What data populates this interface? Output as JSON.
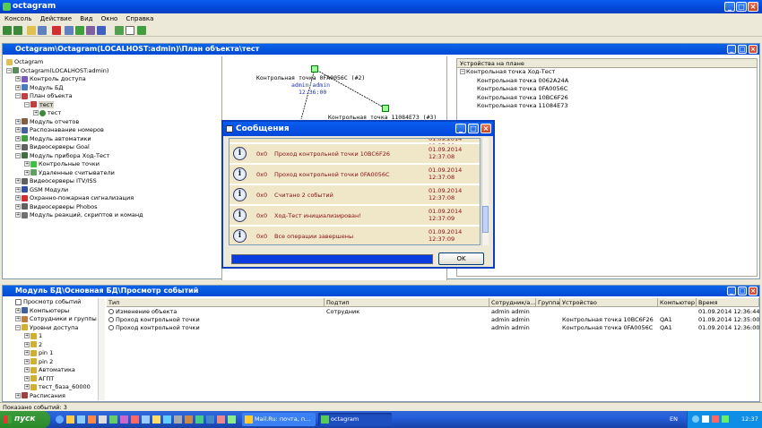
{
  "app": {
    "title": "octagram"
  },
  "menu": [
    "Консоль",
    "Действие",
    "Вид",
    "Окно",
    "Справка"
  ],
  "plan_window": {
    "title": "Octagram\\Octagram(LOCALHOST:admin)\\План объекта\\тест",
    "tree": [
      {
        "label": "Octagram",
        "level": 0
      },
      {
        "label": "Octagram(LOCALHOST:admin)",
        "level": 0
      },
      {
        "label": "Контроль доступа",
        "level": 1
      },
      {
        "label": "Модуль БД",
        "level": 1
      },
      {
        "label": "План объекта",
        "level": 1
      },
      {
        "label": "тест",
        "level": 2
      },
      {
        "label": "тест",
        "level": 3
      },
      {
        "label": "Модуль отчетов",
        "level": 1
      },
      {
        "label": "Распознавание номеров",
        "level": 1
      },
      {
        "label": "Модуль автоматики",
        "level": 1
      },
      {
        "label": "Видеосерверы Goal",
        "level": 1
      },
      {
        "label": "Модуль прибора Ход-Тест",
        "level": 1
      },
      {
        "label": "Контрольные точки",
        "level": 2
      },
      {
        "label": "Удаленные считыватели",
        "level": 2
      },
      {
        "label": "Видеосерверы ITV/ISS",
        "level": 1
      },
      {
        "label": "GSM Модули",
        "level": 1
      },
      {
        "label": "Охранно-пожарная сигнализация",
        "level": 1
      },
      {
        "label": "Видеосерверы Phobos",
        "level": 1
      },
      {
        "label": "Модуль реакций, скриптов и команд",
        "level": 1
      }
    ],
    "plan": {
      "point1_label": "Контрольная точка 0FA0056C (#2)",
      "point1_user": "admin admin",
      "point1_time": "12:36:00",
      "point2_label": "Контрольная точка 11084E73 (#3)"
    },
    "devices": {
      "header": "Устройства на плане",
      "root": "Контрольная точка Ход-Тест",
      "items": [
        "Контрольная точка 0062A24A",
        "Контрольная точка 0FA0056C",
        "Контрольная точка 10BC6F26",
        "Контрольная точка 11084E73"
      ]
    }
  },
  "dialog": {
    "title": "Сообщения",
    "partial_top": "01.09.2014 12:37:08",
    "messages": [
      {
        "code": "0x0",
        "text": "Проход контрольной точки 10BC6F26",
        "date": "01.09.2014",
        "time": "12:37:08"
      },
      {
        "code": "0x0",
        "text": "Проход контрольной точки 0FA0056C",
        "date": "01.09.2014",
        "time": "12:37:08"
      },
      {
        "code": "0x0",
        "text": "Считано 2 событий",
        "date": "01.09.2014",
        "time": "12:37:08"
      },
      {
        "code": "0x0",
        "text": "Ход-Тест инициализирован!",
        "date": "01.09.2014",
        "time": "12:37:09"
      },
      {
        "code": "0x0",
        "text": "Все операции завершены",
        "date": "01.09.2014",
        "time": "12:37:09"
      }
    ],
    "ok_label": "OK",
    "progress": 1.0
  },
  "events_window": {
    "title": "Модуль БД\\Основная БД\\Просмотр событий",
    "tree": [
      {
        "label": "Просмотр событий",
        "level": 0
      },
      {
        "label": "Компьютеры",
        "level": 0
      },
      {
        "label": "Сотрудники и группы",
        "level": 0
      },
      {
        "label": "Уровни доступа",
        "level": 0
      },
      {
        "label": "1",
        "level": 1
      },
      {
        "label": "2",
        "level": 1
      },
      {
        "label": "pin 1",
        "level": 1
      },
      {
        "label": "pin 2",
        "level": 1
      },
      {
        "label": "Автоматика",
        "level": 1
      },
      {
        "label": "АГПТ",
        "level": 1
      },
      {
        "label": "тест_база_60000",
        "level": 1
      },
      {
        "label": "Расписания",
        "level": 0
      }
    ],
    "columns": [
      "Тип",
      "Подтип",
      "Сотрудник/а...",
      "Группа",
      "Устройство",
      "Компьютер",
      "Время"
    ],
    "rows": [
      [
        "Изменение объекта",
        "Сотрудник",
        "admin admin",
        "",
        "",
        "",
        "01.09.2014 12:36:44"
      ],
      [
        "Проход контрольной точки",
        "",
        "admin admin",
        "",
        "Контрольная точка 10BC6F26",
        "QA1",
        "01.09.2014 12:35:00"
      ],
      [
        "Проход контрольной точки",
        "",
        "admin admin",
        "",
        "Контрольная точка 0FA0056C",
        "QA1",
        "01.09.2014 12:36:00"
      ]
    ]
  },
  "status": {
    "text": "Показано событий: 3"
  },
  "taskbar": {
    "start": "пуск",
    "tasks": [
      "Mail.Ru: почта, п...",
      "octagram"
    ],
    "lang": "EN",
    "clock": "12:37"
  },
  "colors": {
    "accent": "#0a5cf0",
    "message_text": "#8b1010",
    "message_bg": "#f0e6c8"
  }
}
